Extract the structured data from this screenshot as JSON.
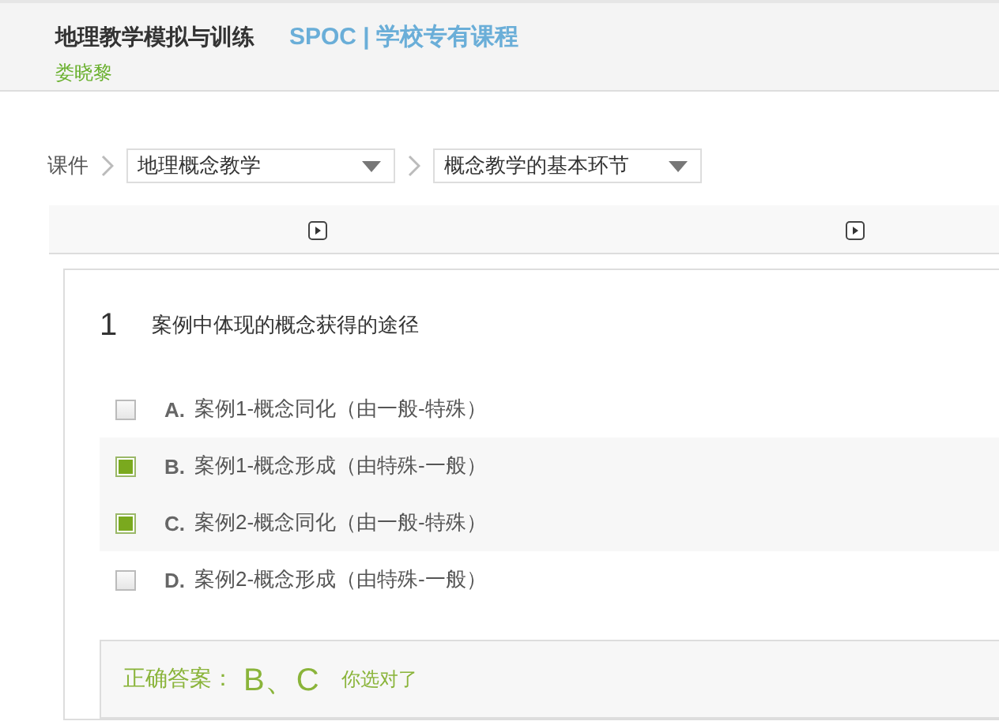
{
  "header": {
    "course_title": "地理教学模拟与训练",
    "course_type": "SPOC | 学校专有课程",
    "teacher": "娄晓黎"
  },
  "breadcrumb": {
    "root": "课件",
    "selects": [
      {
        "value": "地理概念教学"
      },
      {
        "value": "概念教学的基本环节"
      }
    ]
  },
  "unit_bar": {
    "items": [
      {
        "kind": "video"
      },
      {
        "kind": "video"
      }
    ]
  },
  "question": {
    "number": "1",
    "text": "案例中体现的概念获得的途径",
    "options": [
      {
        "letter": "A.",
        "text": "案例1-概念同化（由一般-特殊）",
        "checked": false
      },
      {
        "letter": "B.",
        "text": "案例1-概念形成（由特殊-一般）",
        "checked": true
      },
      {
        "letter": "C.",
        "text": "案例2-概念同化（由一般-特殊）",
        "checked": true
      },
      {
        "letter": "D.",
        "text": "案例2-概念形成（由特殊-一般）",
        "checked": false
      }
    ],
    "answer": {
      "label": "正确答案：",
      "value": "B、C",
      "feedback": "你选对了"
    }
  }
}
